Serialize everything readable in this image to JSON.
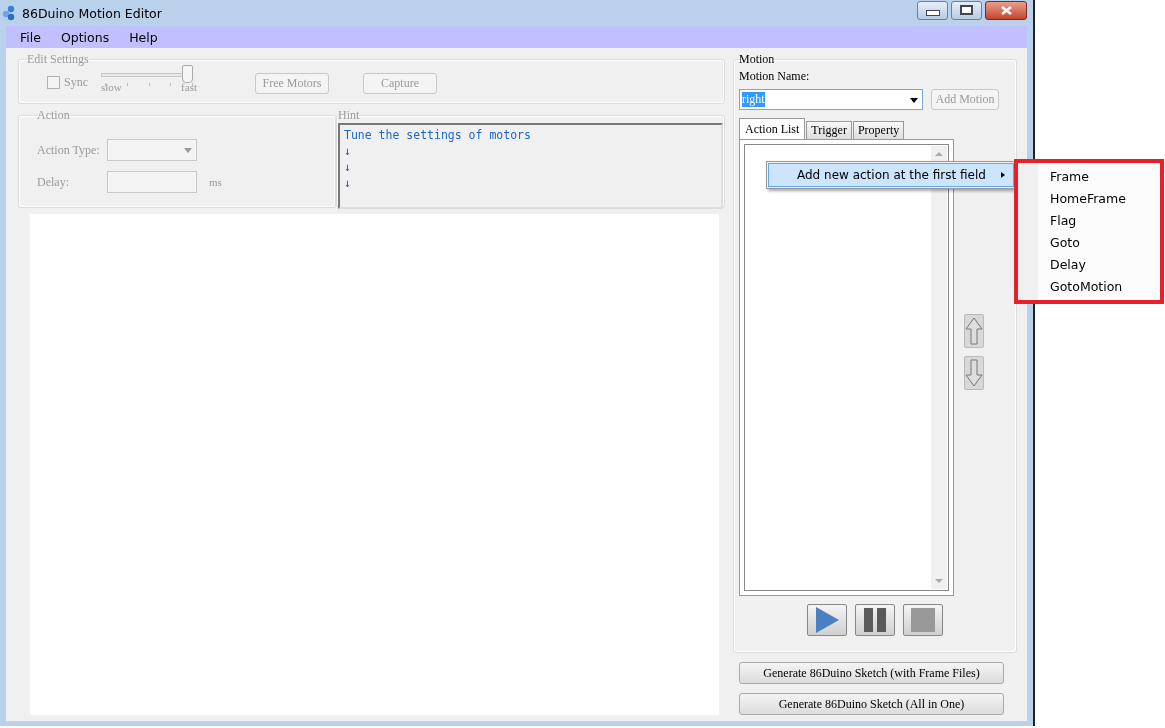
{
  "window": {
    "title": "86Duino Motion Editor"
  },
  "menu": [
    "File",
    "Options",
    "Help"
  ],
  "edit_settings": {
    "title": "Edit Settings",
    "disabled": true,
    "sync": {
      "label": "Sync",
      "checked": false
    },
    "speed": {
      "level": 0.94,
      "min_label": "slow",
      "max_label": "fast"
    },
    "buttons": [
      "Free Motors",
      "Capture"
    ]
  },
  "action": {
    "title": "Action",
    "type_label": "Action Type:",
    "delay_label": "Delay:",
    "unit": "ms"
  },
  "hint": {
    "title": "Hint",
    "lines": [
      "Tune the settings of motors",
      "↓",
      "↓",
      "↓"
    ]
  },
  "motion": {
    "title": "Motion",
    "name_label": "Motion Name:",
    "name_value": "right",
    "add_button": "Add Motion",
    "tabs": [
      {
        "label": "Action List",
        "selected": true
      },
      {
        "label": "Trigger",
        "selected": false
      },
      {
        "label": "Property",
        "selected": false
      }
    ]
  },
  "context_menu": {
    "item": "Add new action at the first field",
    "submenu": [
      "Frame",
      "HomeFrame",
      "Flag",
      "Goto",
      "Delay",
      "GotoMotion"
    ]
  },
  "generate_buttons": [
    "Generate 86Duino Sketch (with Frame Files)",
    "Generate 86Duino Sketch (All in One)"
  ]
}
